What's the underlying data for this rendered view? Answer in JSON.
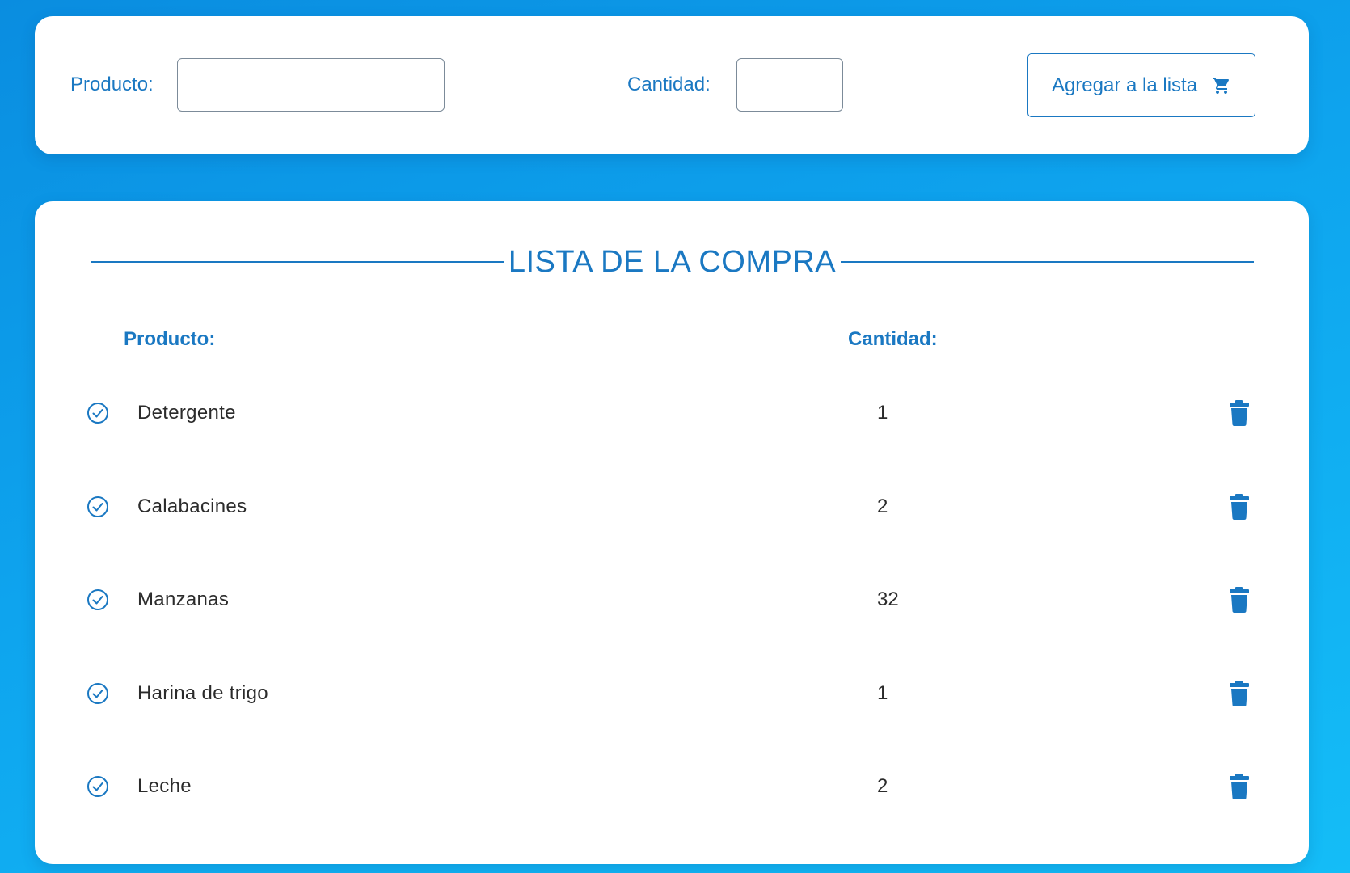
{
  "form": {
    "product_label": "Producto:",
    "product_value": "",
    "product_placeholder": "",
    "quantity_label": "Cantidad:",
    "quantity_value": "",
    "quantity_placeholder": "",
    "add_button_label": "Agregar a la lista",
    "add_button_icon": "cart-icon"
  },
  "list": {
    "title": "LISTA DE LA COMPRA",
    "headers": {
      "product": "Producto:",
      "quantity": "Cantidad:"
    },
    "items": [
      {
        "name": "Detergente",
        "quantity": "1"
      },
      {
        "name": "Calabacines",
        "quantity": "2"
      },
      {
        "name": "Manzanas",
        "quantity": "32"
      },
      {
        "name": "Harina de trigo",
        "quantity": "1"
      },
      {
        "name": "Leche",
        "quantity": "2"
      }
    ],
    "row_icons": {
      "check": "check-circle-icon",
      "delete": "trash-icon"
    }
  },
  "colors": {
    "accent": "#1a78c2",
    "background_top": "#0a8de0",
    "background_bottom": "#14bdf7",
    "card": "#ffffff",
    "text": "#2b2b2b"
  }
}
